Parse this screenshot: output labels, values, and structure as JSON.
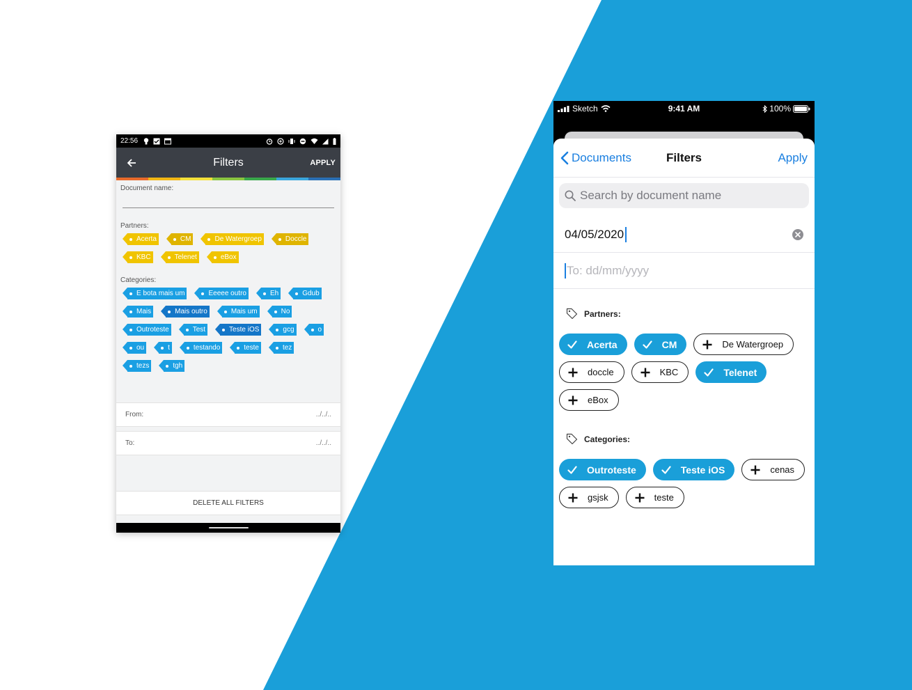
{
  "colors": {
    "accent_blue": "#1a9fd9",
    "ios_link": "#1a7fe0",
    "android_toolbar": "#3b3f46",
    "tag_yellow": "#f0c400",
    "tag_blue": "#1a9fe3"
  },
  "android": {
    "status": {
      "time": "22:56"
    },
    "toolbar": {
      "title": "Filters",
      "apply": "APPLY",
      "back_icon": "arrow-left-icon"
    },
    "rainbow": [
      "#e86a2a",
      "#f2b714",
      "#f4e13a",
      "#8ac540",
      "#39a84a",
      "#3aa6dc",
      "#2a6fb4"
    ],
    "document_name_label": "Document name:",
    "partners_label": "Partners:",
    "partners": [
      {
        "label": "Acerta",
        "shade": "y"
      },
      {
        "label": "CM",
        "shade": "y dk"
      },
      {
        "label": "De Watergroep",
        "shade": "y"
      },
      {
        "label": "Doccle",
        "shade": "y dk"
      },
      {
        "label": "KBC",
        "shade": "y"
      },
      {
        "label": "Telenet",
        "shade": "y"
      },
      {
        "label": "eBox",
        "shade": "y"
      }
    ],
    "categories_label": "Categories:",
    "categories": [
      {
        "label": "E bota mais um",
        "shade": "b"
      },
      {
        "label": "Eeeee outro",
        "shade": "b"
      },
      {
        "label": "Eh",
        "shade": "b"
      },
      {
        "label": "Gdub",
        "shade": "b"
      },
      {
        "label": "Mais",
        "shade": "b"
      },
      {
        "label": "Mais outro",
        "shade": "b dk"
      },
      {
        "label": "Mais um",
        "shade": "b"
      },
      {
        "label": "No",
        "shade": "b"
      },
      {
        "label": "Outroteste",
        "shade": "b"
      },
      {
        "label": "Test",
        "shade": "b"
      },
      {
        "label": "Teste iOS",
        "shade": "b dk"
      },
      {
        "label": "gcg",
        "shade": "b"
      },
      {
        "label": "o",
        "shade": "b"
      },
      {
        "label": "ou",
        "shade": "b"
      },
      {
        "label": "t",
        "shade": "b"
      },
      {
        "label": "testando",
        "shade": "b"
      },
      {
        "label": "teste",
        "shade": "b"
      },
      {
        "label": "tez",
        "shade": "b"
      },
      {
        "label": "tezs",
        "shade": "b"
      },
      {
        "label": "tgh",
        "shade": "b"
      }
    ],
    "from_label": "From:",
    "from_placeholder": "../../..",
    "to_label": "To:",
    "to_placeholder": "../../..",
    "delete_all": "DELETE ALL FILTERS"
  },
  "ios": {
    "status": {
      "carrier": "Sketch",
      "time": "9:41 AM",
      "battery": "100%"
    },
    "nav": {
      "back": "Documents",
      "title": "Filters",
      "apply": "Apply"
    },
    "search": {
      "placeholder": "Search by document name"
    },
    "from_value": "04/05/2020",
    "to_placeholder": "To: dd/mm/yyyy",
    "partners_label": "Partners:",
    "partners": [
      {
        "label": "Acerta",
        "selected": true
      },
      {
        "label": "CM",
        "selected": true
      },
      {
        "label": "De Watergroep",
        "selected": false
      },
      {
        "label": "doccle",
        "selected": false
      },
      {
        "label": "KBC",
        "selected": false
      },
      {
        "label": "Telenet",
        "selected": true
      },
      {
        "label": "eBox",
        "selected": false
      }
    ],
    "categories_label": "Categories:",
    "categories": [
      {
        "label": "Outroteste",
        "selected": true
      },
      {
        "label": "Teste iOS",
        "selected": true
      },
      {
        "label": "cenas",
        "selected": false
      },
      {
        "label": "gsjsk",
        "selected": false
      },
      {
        "label": "teste",
        "selected": false
      }
    ]
  }
}
